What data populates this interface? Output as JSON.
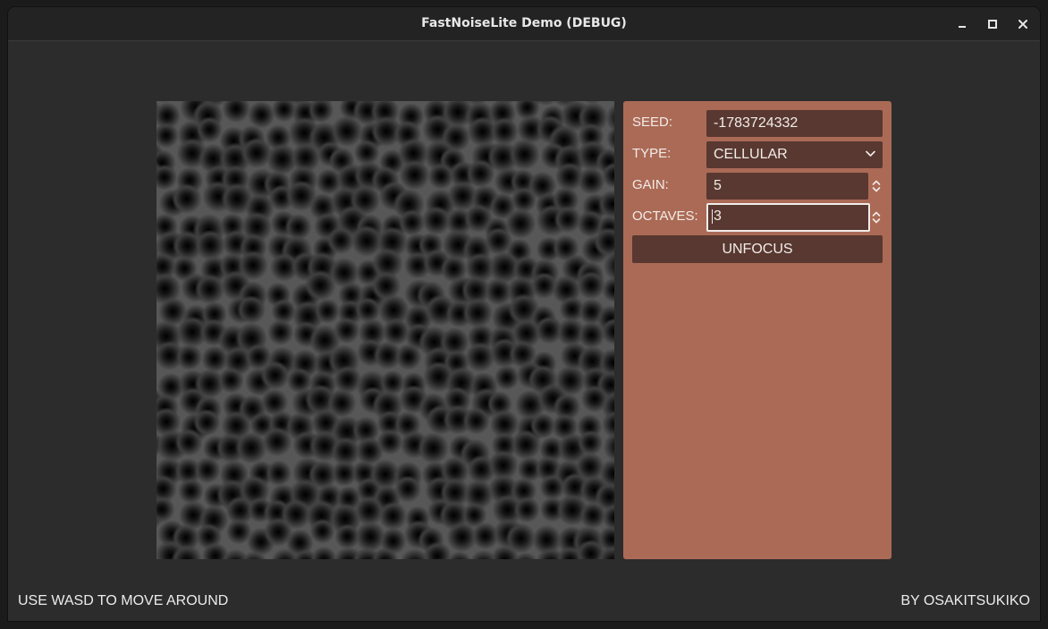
{
  "window": {
    "title": "FastNoiseLite Demo (DEBUG)"
  },
  "panel": {
    "seed_label": "SEED:",
    "seed_value": "-1783724332",
    "type_label": "TYPE:",
    "type_value": "CELLULAR",
    "gain_label": "GAIN:",
    "gain_value": "5",
    "octaves_label": "OCTAVES:",
    "octaves_value": "3",
    "unfocus_label": "UNFOCUS"
  },
  "footer": {
    "hint": "USE WASD TO MOVE AROUND",
    "credit": "BY OSAKITSUKIKO"
  },
  "colors": {
    "window_bg": "#2c2c2c",
    "panel_bg": "#ab6a56",
    "field_bg": "#583830"
  },
  "icons": {
    "minimize": "minimize-icon",
    "maximize": "maximize-icon",
    "close": "close-icon",
    "dropdown": "chevron-down-icon",
    "spinner": "spinner-arrows-icon"
  }
}
